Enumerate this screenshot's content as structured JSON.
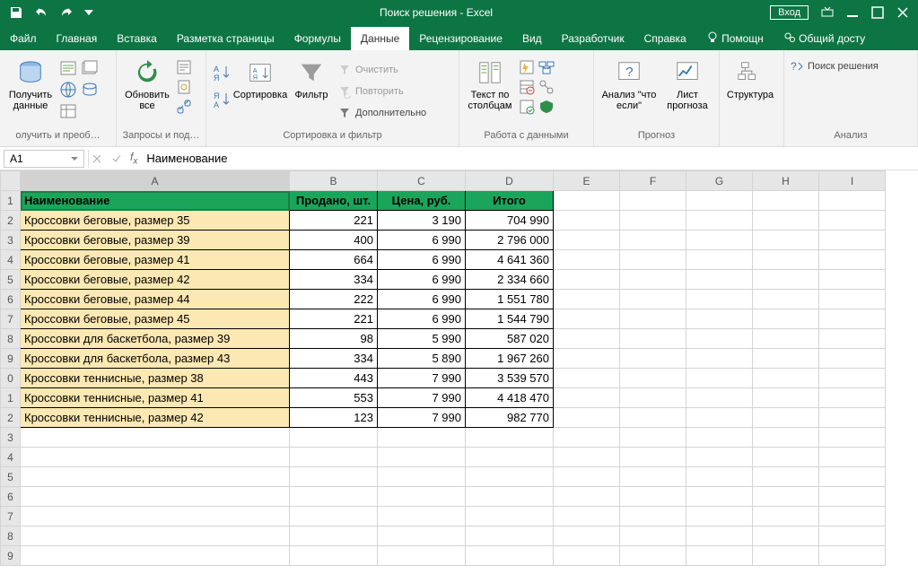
{
  "titlebar": {
    "title": "Поиск решения  -  Excel",
    "login": "Вход"
  },
  "tabs": {
    "file": "Файл",
    "home": "Главная",
    "insert": "Вставка",
    "layout": "Разметка страницы",
    "formulas": "Формулы",
    "data": "Данные",
    "review": "Рецензирование",
    "view": "Вид",
    "developer": "Разработчик",
    "help": "Справка",
    "tellme": "Помощн",
    "share": "Общий досту"
  },
  "ribbon": {
    "get_data": "Получить данные",
    "g1_label": "олучить и преоб…",
    "refresh": "Обновить все",
    "g2_label": "Запросы и под…",
    "sort": "Сортировка",
    "filter": "Фильтр",
    "clear": "Очистить",
    "reapply": "Повторить",
    "advanced": "Дополнительно",
    "g3_label": "Сортировка и фильтр",
    "ttc": "Текст по столбцам",
    "g4_label": "Работа с данными",
    "whatif": "Анализ \"что если\"",
    "forecast_sheet": "Лист прогноза",
    "g5_label": "Прогноз",
    "structure": "Структура",
    "solver": "Поиск решения",
    "g6_label": "Анализ"
  },
  "formula": {
    "cell": "A1",
    "value": "Наименование"
  },
  "columns": [
    "A",
    "B",
    "C",
    "D",
    "E",
    "F",
    "G",
    "H",
    "I"
  ],
  "row_labels": [
    "1",
    "2",
    "3",
    "4",
    "5",
    "6",
    "7",
    "8",
    "9",
    "0",
    "1",
    "2",
    "3",
    "4",
    "5",
    "6",
    "7",
    "8",
    "9"
  ],
  "headers": {
    "A": "Наименование",
    "B": "Продано, шт.",
    "C": "Цена, руб.",
    "D": "Итого"
  },
  "rows": [
    {
      "name": "Кроссовки беговые, размер 35",
      "sold": "221",
      "price": "3 190",
      "total": "704 990"
    },
    {
      "name": "Кроссовки беговые, размер 39",
      "sold": "400",
      "price": "6 990",
      "total": "2 796 000"
    },
    {
      "name": "Кроссовки беговые, размер 41",
      "sold": "664",
      "price": "6 990",
      "total": "4 641 360"
    },
    {
      "name": "Кроссовки беговые, размер 42",
      "sold": "334",
      "price": "6 990",
      "total": "2 334 660"
    },
    {
      "name": "Кроссовки беговые, размер 44",
      "sold": "222",
      "price": "6 990",
      "total": "1 551 780"
    },
    {
      "name": "Кроссовки беговые, размер 45",
      "sold": "221",
      "price": "6 990",
      "total": "1 544 790"
    },
    {
      "name": "Кроссовки для баскетбола, размер 39",
      "sold": "98",
      "price": "5 990",
      "total": "587 020"
    },
    {
      "name": "Кроссовки для баскетбола, размер 43",
      "sold": "334",
      "price": "5 890",
      "total": "1 967 260"
    },
    {
      "name": "Кроссовки теннисные, размер 38",
      "sold": "443",
      "price": "7 990",
      "total": "3 539 570"
    },
    {
      "name": "Кроссовки теннисные, размер 41",
      "sold": "553",
      "price": "7 990",
      "total": "4 418 470"
    },
    {
      "name": "Кроссовки теннисные, размер 42",
      "sold": "123",
      "price": "7 990",
      "total": "982 770"
    }
  ]
}
